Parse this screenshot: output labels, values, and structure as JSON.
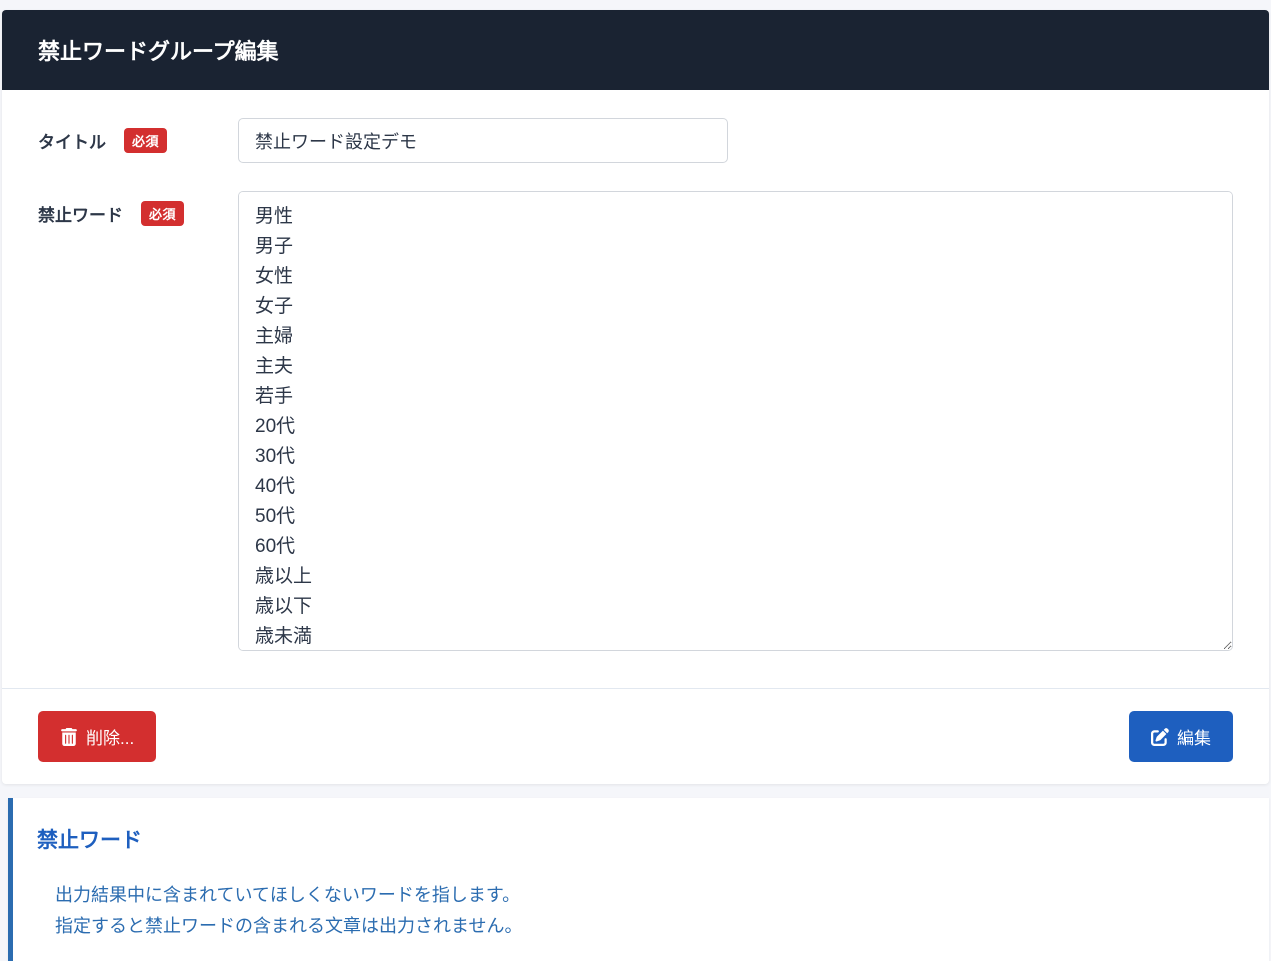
{
  "header": {
    "title": "禁止ワードグループ編集"
  },
  "form": {
    "title_label": "タイトル",
    "title_required": "必須",
    "title_value": "禁止ワード設定デモ",
    "words_label": "禁止ワード",
    "words_required": "必須",
    "words_value": "男性\n男子\n女性\n女子\n主婦\n主夫\n若手\n20代\n30代\n40代\n50代\n60代\n歳以上\n歳以下\n歳未満"
  },
  "footer": {
    "delete_label": "削除...",
    "edit_label": "編集"
  },
  "info": {
    "title": "禁止ワード",
    "line1": "出力結果中に含まれていてほしくないワードを指します。",
    "line2": "指定すると禁止ワードの含まれる文章は出力されません。"
  }
}
